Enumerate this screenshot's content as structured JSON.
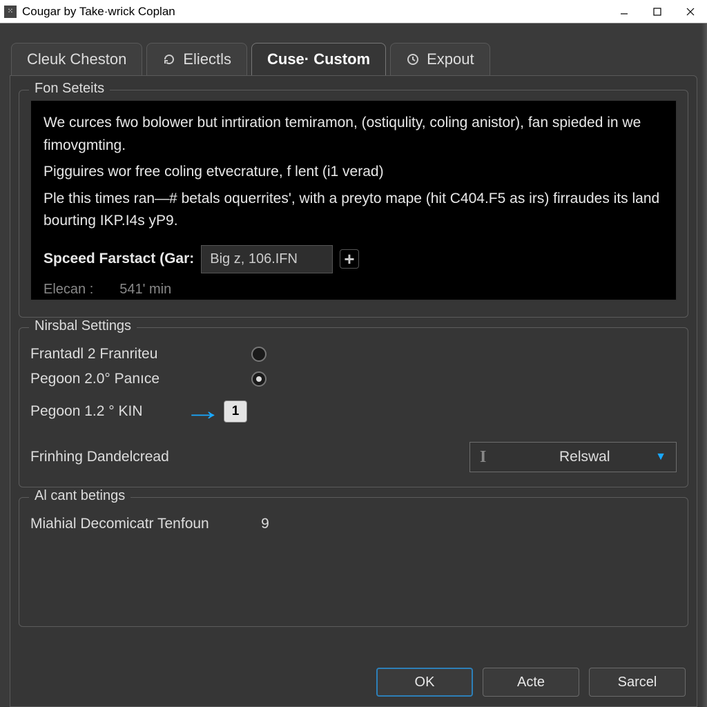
{
  "window": {
    "title": "Cougar by Take·wrick Coplan"
  },
  "tabs": [
    {
      "label": "Cleuk Cheston",
      "icon": null
    },
    {
      "label": "Eliectls",
      "icon": "refresh"
    },
    {
      "label": "Cuse· Custom",
      "icon": null,
      "active": true
    },
    {
      "label": "Expout",
      "icon": "clock"
    }
  ],
  "group_fon": {
    "legend": "Fon Seteits",
    "line1": "We curces fwo bolower but inrtiration temiramon, (ostiqulity, coling anistor), fan spieded in we fimovgmting.",
    "line2": "Pigguires wor free coling etvecrature, f lent (i1 verad)",
    "line3": "Ple this times ran—# betals oquerrites', with a preyto mape (hit C404.F5 as irs) firraudes its land bourting IKP.I4s yP9.",
    "speed_label": "Spceed Farstact (Gar:",
    "speed_value": "Big z, 106.IFN",
    "elecan_label": "Elecan :",
    "elecan_value": "541' min"
  },
  "group_nir": {
    "legend": "Nirsbal Settings",
    "rows": [
      {
        "label": "Frantadl  2 Franriteu",
        "kind": "radio",
        "value": "O"
      },
      {
        "label": "Pegoon  2.0°  Panıce",
        "kind": "radio-sel",
        "value": ""
      },
      {
        "label": "Pegoon  1.2 °  KIN",
        "kind": "spin",
        "value": "1",
        "arrow": true
      }
    ],
    "frin_label": "Frinhing Dandelcread",
    "dropdown_value": "Relswal"
  },
  "group_al": {
    "legend": "Al cant betings",
    "row_label": "Miahial Decomicatr Tenfoun",
    "row_value": "9"
  },
  "footer": {
    "ok": "OK",
    "acte": "Acte",
    "sarcel": "Sarcel"
  }
}
